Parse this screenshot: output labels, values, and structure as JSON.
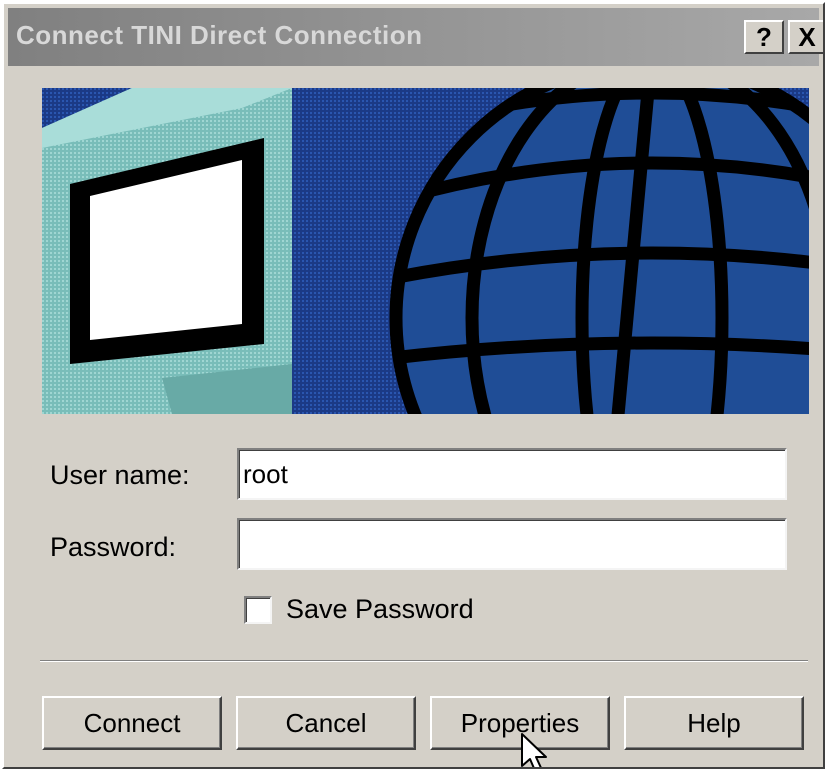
{
  "window": {
    "title": "Connect TINI Direct Connection",
    "help_button": "?",
    "close_button": "X"
  },
  "banner": {
    "icon_monitor": "monitor-icon",
    "icon_globe": "globe-icon",
    "colors": {
      "background": "#1d3f8c",
      "globe": "#1f4d96",
      "monitor": "#7fc3c0"
    }
  },
  "form": {
    "username_label": "User name:",
    "username_value": "root",
    "password_label": "Password:",
    "password_value": "",
    "save_password_label": "Save Password",
    "save_password_checked": false
  },
  "buttons": {
    "connect": "Connect",
    "cancel": "Cancel",
    "properties": "Properties",
    "help": "Help"
  },
  "cursor": "mouse-pointer-icon"
}
